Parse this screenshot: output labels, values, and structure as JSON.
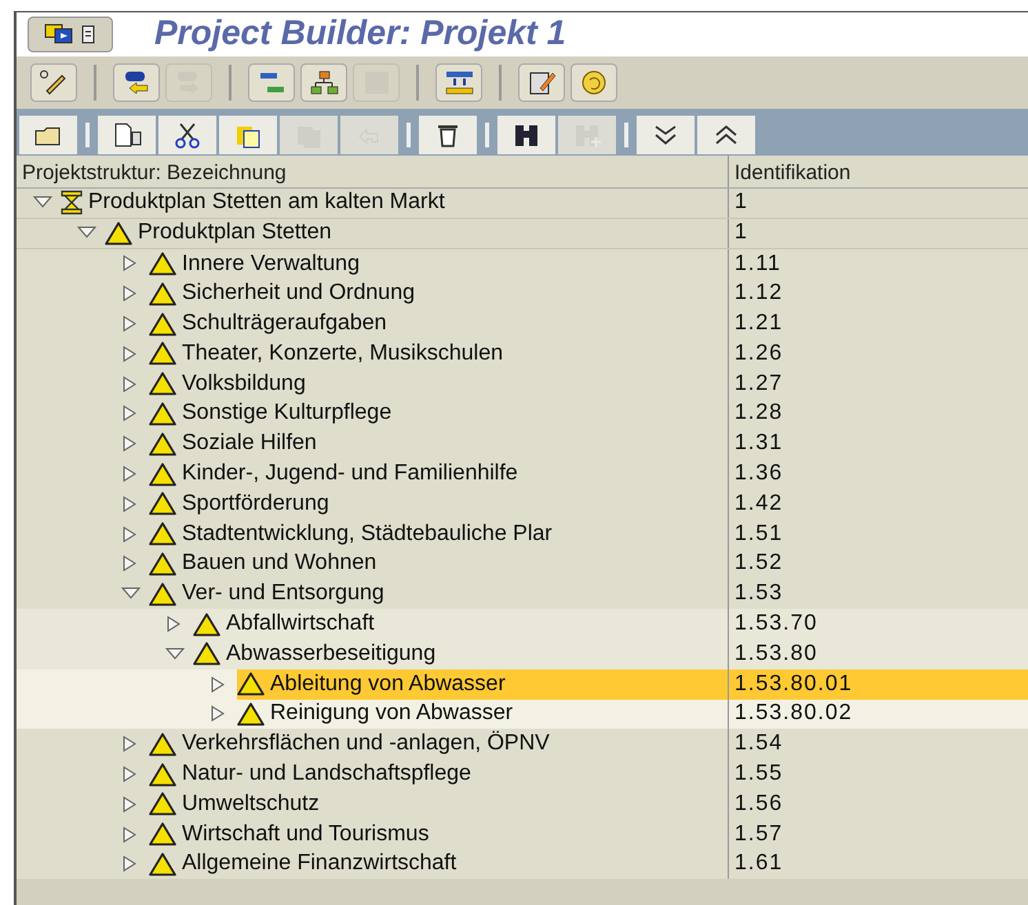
{
  "window": {
    "title": "Project Builder: Projekt 1"
  },
  "toolbar": [
    {
      "disabled": false
    },
    {
      "disabled": false
    },
    {
      "disabled": true
    },
    {
      "disabled": false
    },
    {
      "disabled": false
    },
    {
      "disabled": true
    },
    {
      "disabled": false
    },
    {
      "disabled": false
    },
    {
      "disabled": false
    }
  ],
  "tree_toolbar": [
    {
      "disabled": false
    },
    {
      "disabled": false
    },
    {
      "disabled": false
    },
    {
      "disabled": false
    },
    {
      "disabled": true
    },
    {
      "disabled": true
    },
    {
      "disabled": false
    },
    {
      "disabled": false
    },
    {
      "disabled": true
    },
    {
      "disabled": false
    },
    {
      "disabled": false
    }
  ],
  "tree": {
    "columns": [
      "Projektstruktur: Bezeichnung",
      "Identifikation"
    ],
    "rows": [
      {
        "kind": "hierarchy",
        "label": "Produktplan Stetten am kalten Markt",
        "id": "1",
        "expanded": true,
        "selected": false,
        "children": [
          {
            "kind": "warning",
            "label": "Produktplan Stetten",
            "id": "1",
            "expanded": true,
            "selected": false,
            "children": [
              {
                "kind": "warning",
                "label": "Innere Verwaltung",
                "id": "1.11",
                "expanded": false,
                "selected": false
              },
              {
                "kind": "warning",
                "label": "Sicherheit und Ordnung",
                "id": "1.12",
                "expanded": false,
                "selected": false
              },
              {
                "kind": "warning",
                "label": "Schulträgeraufgaben",
                "id": "1.21",
                "expanded": false,
                "selected": false
              },
              {
                "kind": "warning",
                "label": "Theater, Konzerte, Musikschulen",
                "id": "1.26",
                "expanded": false,
                "selected": false
              },
              {
                "kind": "warning",
                "label": "Volksbildung",
                "id": "1.27",
                "expanded": false,
                "selected": false
              },
              {
                "kind": "warning",
                "label": "Sonstige Kulturpflege",
                "id": "1.28",
                "expanded": false,
                "selected": false
              },
              {
                "kind": "warning",
                "label": "Soziale Hilfen",
                "id": "1.31",
                "expanded": false,
                "selected": false
              },
              {
                "kind": "warning",
                "label": "Kinder-, Jugend- und Familienhilfe",
                "id": "1.36",
                "expanded": false,
                "selected": false
              },
              {
                "kind": "warning",
                "label": "Sportförderung",
                "id": "1.42",
                "expanded": false,
                "selected": false
              },
              {
                "kind": "warning",
                "label": "Stadtentwicklung, Städtebauliche Plar",
                "id": "1.51",
                "expanded": false,
                "selected": false
              },
              {
                "kind": "warning",
                "label": "Bauen und Wohnen",
                "id": "1.52",
                "expanded": false,
                "selected": false
              },
              {
                "kind": "warning",
                "label": "Ver- und Entsorgung",
                "id": "1.53",
                "expanded": true,
                "selected": false,
                "children": [
                  {
                    "kind": "warning",
                    "label": "Abfallwirtschaft",
                    "id": "1.53.70",
                    "expanded": false,
                    "selected": false
                  },
                  {
                    "kind": "warning",
                    "label": "Abwasserbeseitigung",
                    "id": "1.53.80",
                    "expanded": true,
                    "selected": false,
                    "children": [
                      {
                        "kind": "warning",
                        "label": "Ableitung von Abwasser",
                        "id": "1.53.80.01",
                        "expanded": false,
                        "selected": true
                      },
                      {
                        "kind": "warning",
                        "label": "Reinigung von Abwasser",
                        "id": "1.53.80.02",
                        "expanded": false,
                        "selected": false
                      }
                    ]
                  }
                ]
              },
              {
                "kind": "warning",
                "label": "Verkehrsflächen und -anlagen, ÖPNV",
                "id": "1.54",
                "expanded": false,
                "selected": false
              },
              {
                "kind": "warning",
                "label": "Natur- und Landschaftspflege",
                "id": "1.55",
                "expanded": false,
                "selected": false
              },
              {
                "kind": "warning",
                "label": "Umweltschutz",
                "id": "1.56",
                "expanded": false,
                "selected": false
              },
              {
                "kind": "warning",
                "label": "Wirtschaft und Tourismus",
                "id": "1.57",
                "expanded": false,
                "selected": false
              },
              {
                "kind": "warning",
                "label": "Allgemeine Finanzwirtschaft",
                "id": "1.61",
                "expanded": false,
                "selected": false
              }
            ]
          }
        ]
      }
    ]
  }
}
